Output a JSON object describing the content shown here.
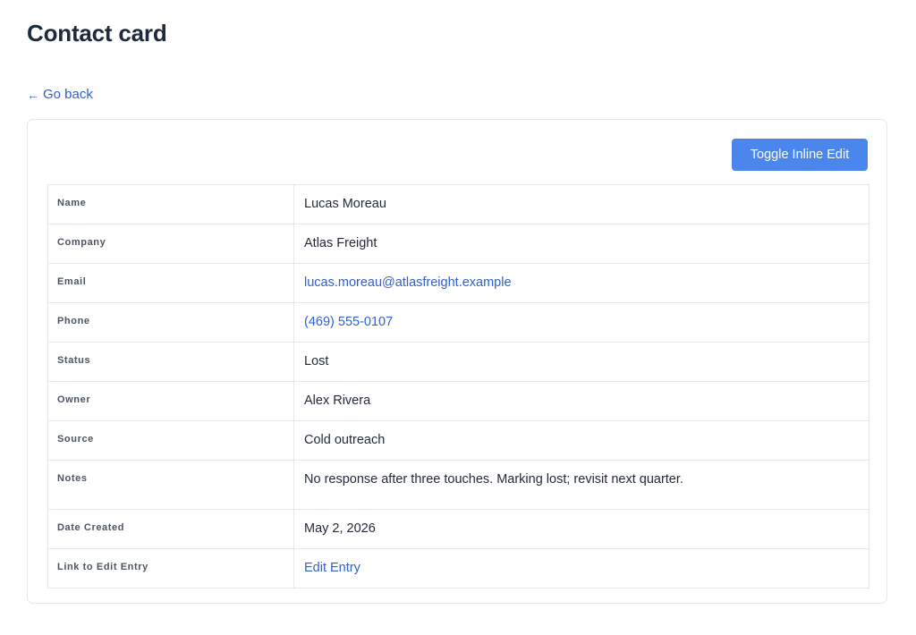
{
  "page": {
    "title": "Contact card",
    "back_link": "Go back"
  },
  "card": {
    "toggle_button_label": "Toggle Inline Edit"
  },
  "fields": {
    "name": {
      "label": "Name",
      "value": "Lucas Moreau"
    },
    "company": {
      "label": "Company",
      "value": "Atlas Freight"
    },
    "email": {
      "label": "Email",
      "value": "lucas.moreau@atlasfreight.example"
    },
    "phone": {
      "label": "Phone",
      "value": "(469) 555-0107"
    },
    "status": {
      "label": "Status",
      "value": "Lost"
    },
    "owner": {
      "label": "Owner",
      "value": "Alex Rivera"
    },
    "source": {
      "label": "Source",
      "value": "Cold outreach"
    },
    "notes": {
      "label": "Notes",
      "value": "No response after three touches. Marking lost; revisit next quarter."
    },
    "date_created": {
      "label": "Date Created",
      "value": "May 2, 2026"
    },
    "edit_link": {
      "label": "Link to Edit Entry",
      "value": "Edit Entry"
    }
  },
  "icons": {
    "back": "arrow-left-icon"
  },
  "colors": {
    "link": "#2f5fd0",
    "button": "#4a86ec",
    "border": "#e5e7eb",
    "title": "#1e293b"
  }
}
